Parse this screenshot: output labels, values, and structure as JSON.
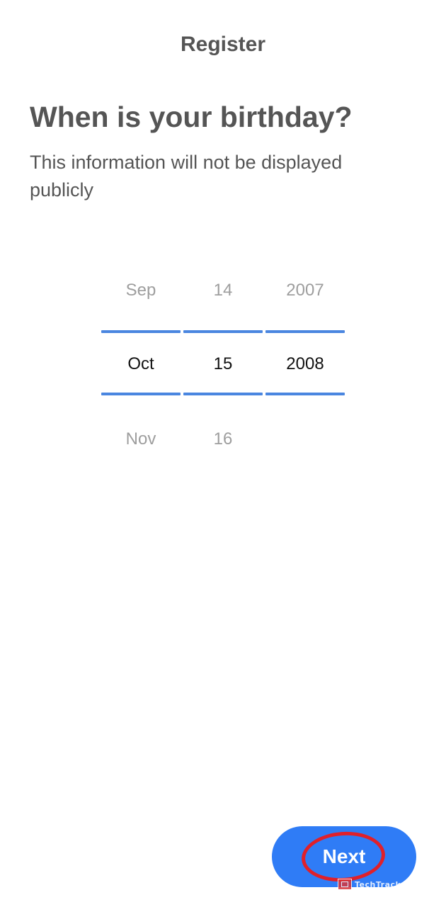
{
  "header": {
    "title": "Register"
  },
  "content": {
    "question": "When is your birthday?",
    "subtitle": "This information will not be displayed publicly"
  },
  "date_picker": {
    "month": {
      "prev": "Sep",
      "selected": "Oct",
      "next": "Nov"
    },
    "day": {
      "prev": "14",
      "selected": "15",
      "next": "16"
    },
    "year": {
      "prev": "2007",
      "selected": "2008",
      "next": ""
    },
    "accent_color": "#4a86e0"
  },
  "footer": {
    "next_label": "Next",
    "button_color": "#2f7cf6",
    "highlight_color": "#e0202a"
  },
  "watermark": {
    "text": "TechTrack",
    "icon": "techtrack-logo-icon"
  }
}
